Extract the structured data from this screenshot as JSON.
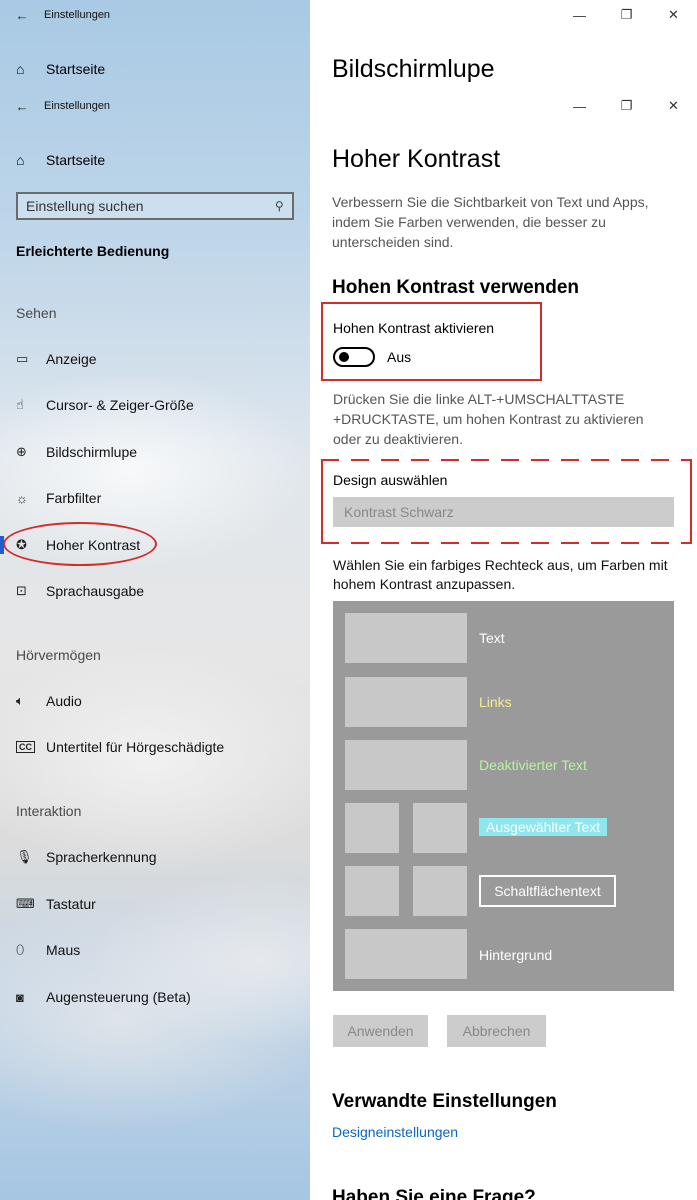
{
  "app": {
    "title": "Einstellungen",
    "back_icon": "←",
    "window_controls": [
      "—",
      "❐",
      "✕"
    ]
  },
  "sidebar": {
    "home": "Startseite",
    "search_placeholder": "Einstellung suchen",
    "section_title": "Erleichterte Bedienung",
    "groups": {
      "sehen": "Sehen",
      "hoeren": "Hörvermögen",
      "interaktion": "Interaktion"
    },
    "items": [
      {
        "label": "Anzeige",
        "icon": "display-icon"
      },
      {
        "label": "Cursor- & Zeiger-Größe",
        "icon": "cursor-icon"
      },
      {
        "label": "Bildschirmlupe",
        "icon": "magnifier-icon"
      },
      {
        "label": "Farbfilter",
        "icon": "color-filter-icon"
      },
      {
        "label": "Hoher Kontrast",
        "icon": "palette-icon",
        "selected": true
      },
      {
        "label": "Sprachausgabe",
        "icon": "narrator-icon"
      },
      {
        "label": "Audio",
        "icon": "speaker-icon"
      },
      {
        "label": "Untertitel für Hörgeschädigte",
        "icon": "cc-icon"
      },
      {
        "label": "Spracherkennung",
        "icon": "microphone-icon"
      },
      {
        "label": "Tastatur",
        "icon": "keyboard-icon"
      },
      {
        "label": "Maus",
        "icon": "mouse-icon"
      },
      {
        "label": "Augensteuerung (Beta)",
        "icon": "eye-control-icon"
      }
    ],
    "accent_color": "#1b5fd1"
  },
  "behind": {
    "home": "Startseite",
    "page_title": "Bildschirmlupe"
  },
  "main": {
    "title": "Hoher Kontrast",
    "description": "Verbessern Sie die Sichtbarkeit von Text und Apps, indem Sie Farben verwenden, die besser zu unterscheiden sind.",
    "use_heading": "Hohen Kontrast verwenden",
    "toggle_label": "Hohen Kontrast aktivieren",
    "toggle_state": "Aus",
    "shortcut_hint": "Drücken Sie die linke ALT-+UMSCHALTTASTE +DRUCKTASTE, um hohen Kontrast zu aktivieren oder zu deaktivieren.",
    "design_label": "Design auswählen",
    "design_value": "Kontrast Schwarz",
    "color_instruction": "Wählen Sie ein farbiges Rechteck aus, um Farben mit hohem Kontrast anzupassen.",
    "preview": {
      "text": "Text",
      "links": "Links",
      "disabled": "Deaktivierter Text",
      "selected": "Ausgewählter Text",
      "button": "Schaltflächentext",
      "background": "Hintergrund"
    },
    "apply": "Anwenden",
    "cancel": "Abbrechen",
    "related_heading": "Verwandte Einstellungen",
    "related_link": "Designeinstellungen",
    "question_heading": "Haben Sie eine Frage?"
  },
  "colors": {
    "annotation_red": "#d52b2b",
    "link_blue": "#0b66c3",
    "preview_links": "#f3ee8e",
    "preview_disabled": "#b8f2a2",
    "preview_selected_bg": "#8ee6ee"
  }
}
